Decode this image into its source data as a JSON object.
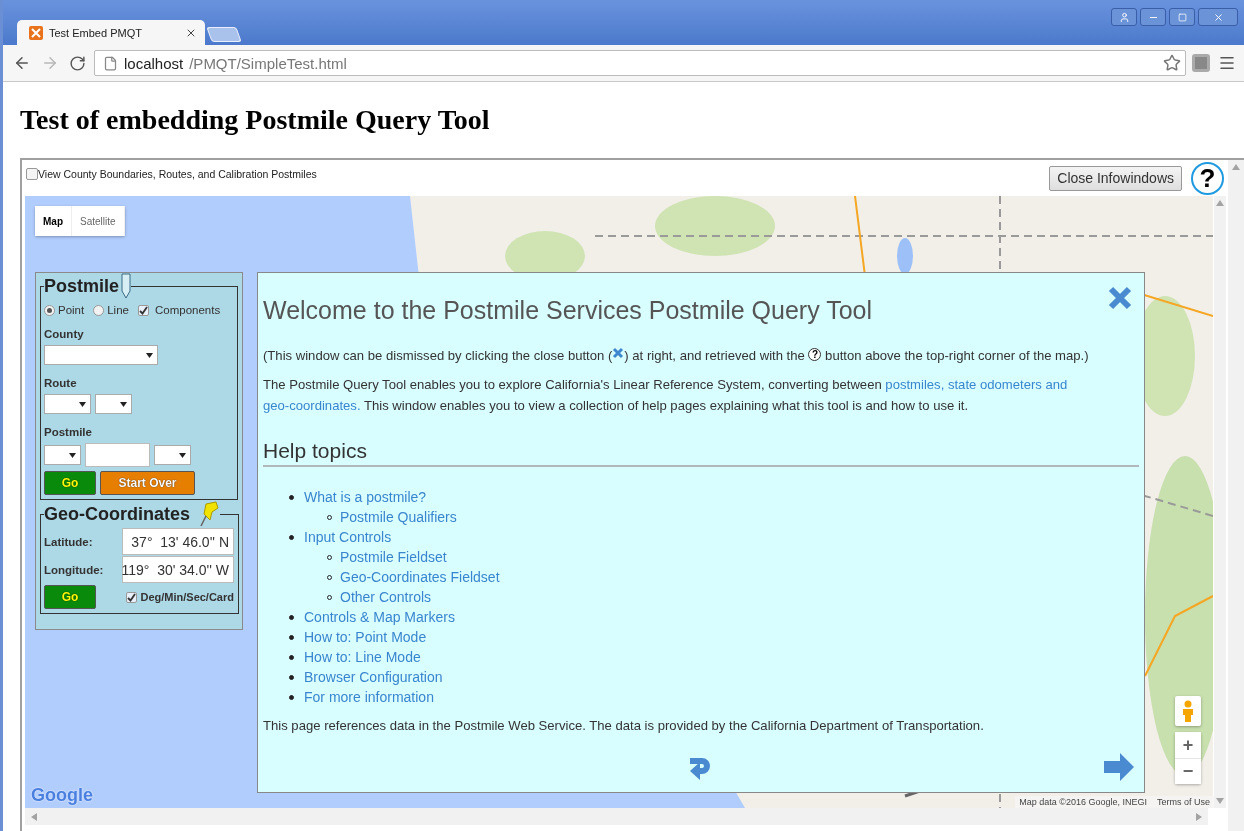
{
  "browser": {
    "tab_title": "Test Embed PMQT",
    "forward_disabled": true,
    "address": {
      "host": "localhost",
      "path": "/PMQT/SimpleTest.html"
    }
  },
  "page": {
    "heading": "Test of embedding Postmile Query Tool"
  },
  "toolbar": {
    "layers_checkbox": {
      "label": "View County Boundaries, Routes, and Calibration Postmiles",
      "checked": false
    },
    "close_button": "Close Infowindows",
    "help_button": "?"
  },
  "map": {
    "map_types": [
      {
        "label": "Map",
        "selected": true
      },
      {
        "label": "Satellite",
        "selected": false
      }
    ],
    "postmile_panel": {
      "title": "Postmile",
      "modes": [
        {
          "label": "Point",
          "selected": true
        },
        {
          "label": "Line",
          "selected": false
        }
      ],
      "components": {
        "label": "Components",
        "checked": true
      },
      "county_label": "County",
      "route_label": "Route",
      "postmile_label": "Postmile",
      "go_button": "Go",
      "start_over_button": "Start Over"
    },
    "geo_panel": {
      "title": "Geo-Coordinates",
      "latitude_label": "Latitude:",
      "latitude": "37°  13' 46.0'' N",
      "longitude_label": "Longitude:",
      "longitude": "119°  30' 34.0'' W",
      "go_button": "Go",
      "dms": {
        "label": "Deg/Min/Sec/Card",
        "checked": true
      }
    },
    "info_window": {
      "title": "Welcome to the Postmile Services Postmile Query Tool",
      "intro": [
        {
          "kind": "text",
          "text": "(This window can be dismissed by clicking the close button ("
        },
        {
          "kind": "close_icon"
        },
        {
          "kind": "text",
          "text": ") at right, and retrieved with the "
        },
        {
          "kind": "help_icon",
          "text": "?"
        },
        {
          "kind": "text",
          "text": " button above the top-right corner of the map.)"
        }
      ],
      "description": [
        {
          "kind": "text",
          "text": "The Postmile Query Tool enables you to explore California's Linear Reference System, converting between "
        },
        {
          "kind": "link",
          "text": "postmiles, state odometers and"
        },
        {
          "kind": "space"
        },
        {
          "kind": "link",
          "text": "geo-coordinates."
        },
        {
          "kind": "text",
          "text": " This window enables you to view a collection of help pages explaining what this tool is and how to use it."
        }
      ],
      "help_heading": "Help topics",
      "help_topics": [
        {
          "label": "What is a postmile?",
          "children": [
            {
              "label": "Postmile Qualifiers"
            }
          ]
        },
        {
          "label": "Input Controls",
          "children": [
            {
              "label": "Postmile Fieldset"
            },
            {
              "label": "Geo-Coordinates Fieldset"
            },
            {
              "label": "Other Controls"
            }
          ]
        },
        {
          "label": "Controls & Map Markers"
        },
        {
          "label": "How to: Point Mode"
        },
        {
          "label": "How to: Line Mode"
        },
        {
          "label": "Browser Configuration"
        },
        {
          "label": "For more information"
        }
      ],
      "footer": "This page references data in the Postmile Web Service. The data is provided by the California Department of Transportation."
    },
    "zoom": {
      "in": "+",
      "out": "−"
    },
    "attribution": {
      "logo": "Google",
      "data": "Map data ©2016 Google, INEGI",
      "terms": "Terms of Use"
    }
  }
}
